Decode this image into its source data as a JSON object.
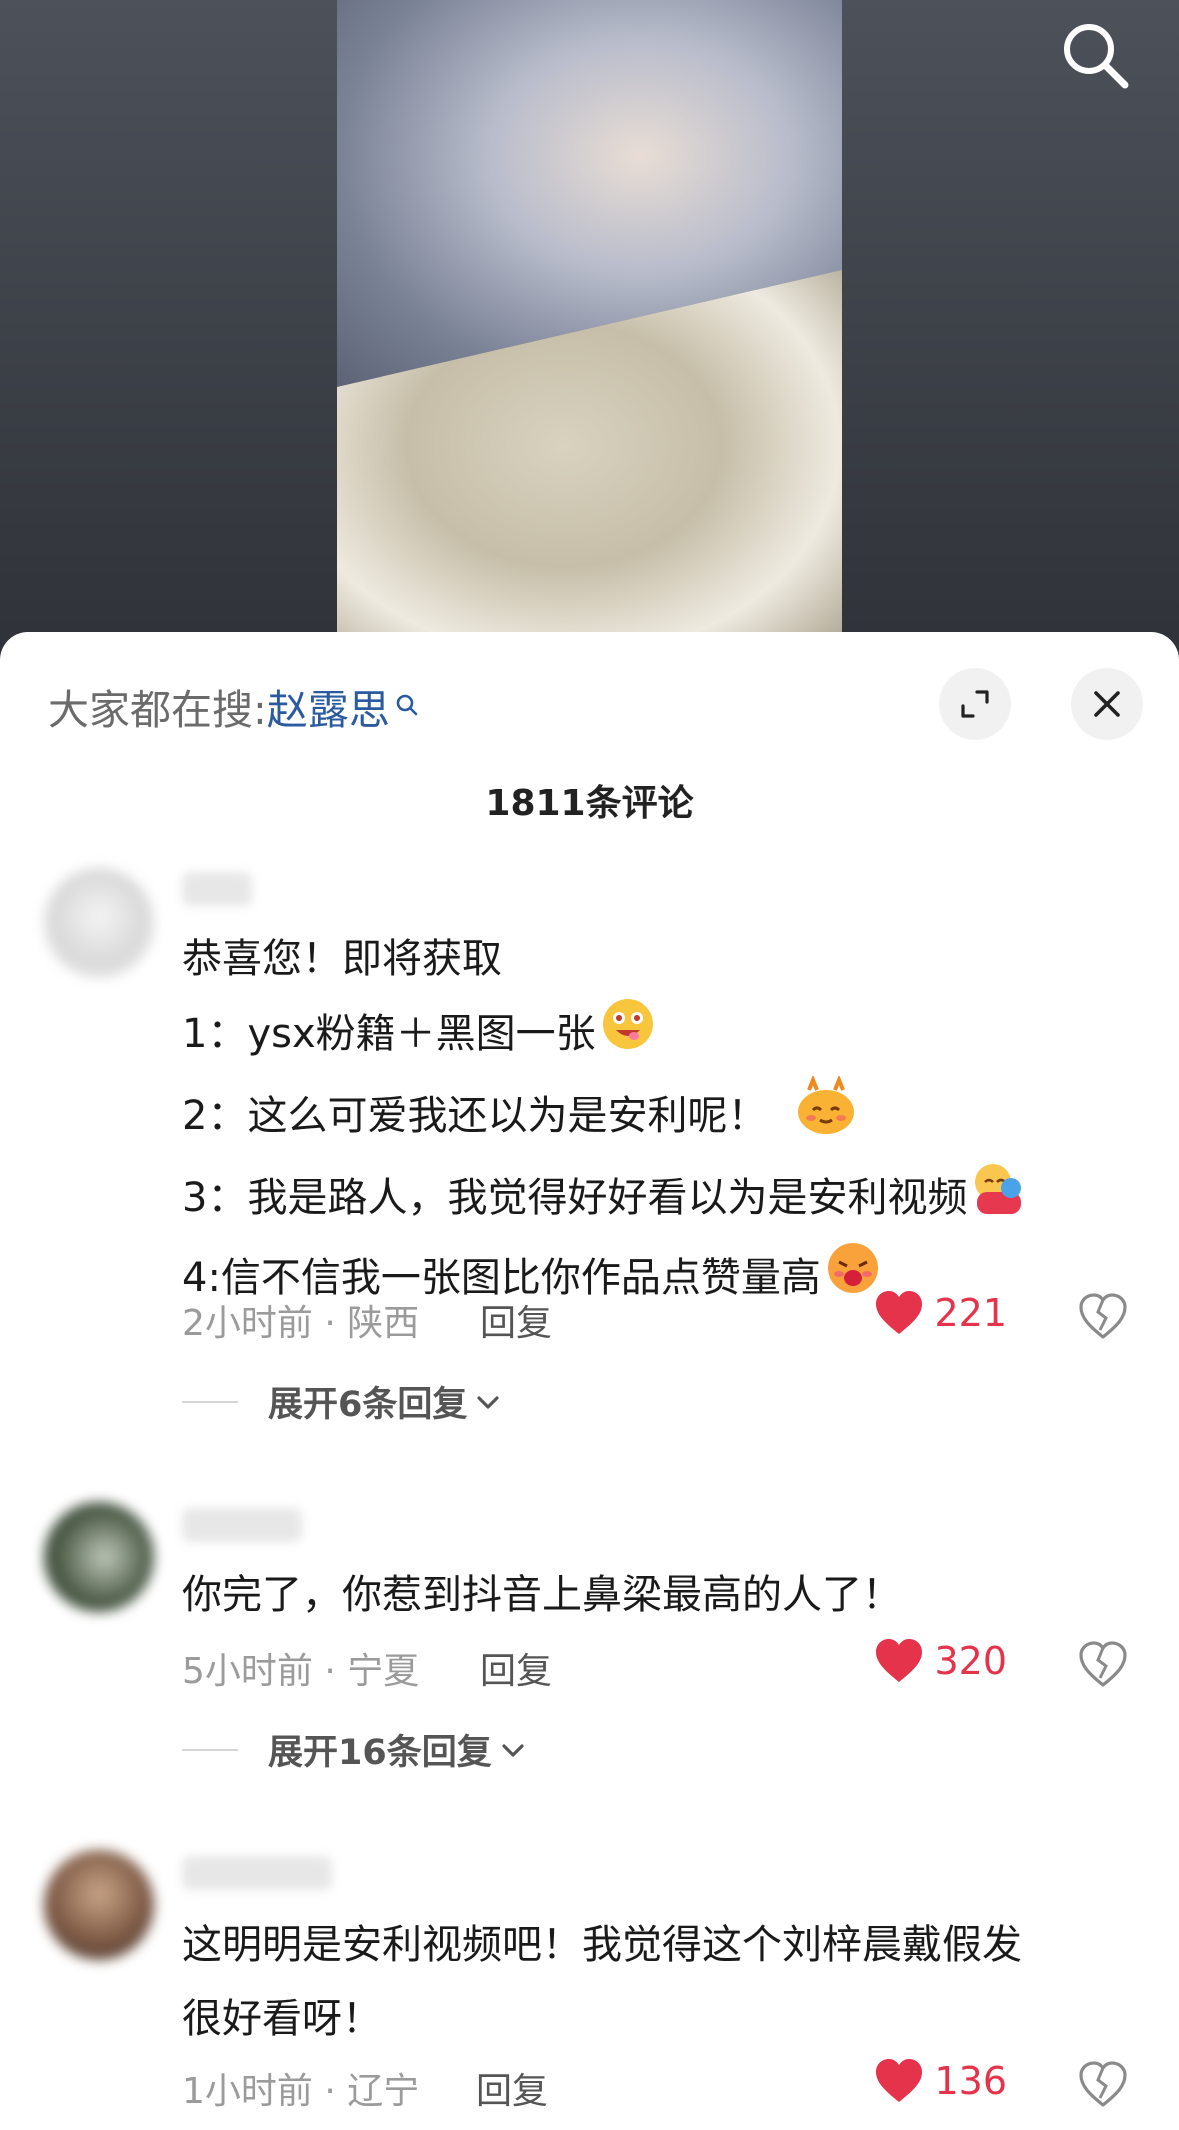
{
  "header": {
    "search_icon": "search-icon"
  },
  "sheet": {
    "search_hint_label": "大家都在搜:",
    "search_hint_keyword": "赵露思",
    "comment_count": "1811条评论",
    "expand_icon": "expand-icon",
    "close_icon": "close-icon"
  },
  "comments": [
    {
      "lines": [
        "恭喜您！即将获取",
        "1：ysx粉籍＋黑图一张",
        "2：这么可爱我还以为是安利呢！",
        "3：我是路人，我觉得好好看以为是安利视频",
        "4:信不信我一张图比你作品点赞量高"
      ],
      "time_location": "2小时前 · 陕西",
      "reply_label": "回复",
      "likes": "221",
      "expand_replies": "展开6条回复"
    },
    {
      "lines": [
        "你完了，你惹到抖音上鼻梁最高的人了！"
      ],
      "time_location": "5小时前 · 宁夏",
      "reply_label": "回复",
      "likes": "320",
      "expand_replies": "展开16条回复"
    },
    {
      "lines": [
        "这明明是安利视频吧！我觉得这个刘梓晨戴假发",
        "很好看呀！"
      ],
      "time_location": "1小时前 · 辽宁",
      "reply_label": "回复",
      "likes": "136"
    }
  ],
  "colors": {
    "like_red": "#e4334a",
    "keyword_blue": "#2a5aa0",
    "meta_gray": "#9b9b9b"
  }
}
